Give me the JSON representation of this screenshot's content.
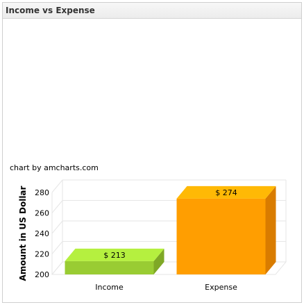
{
  "panel": {
    "title": "Income vs Expense"
  },
  "credit": "chart by amcharts.com",
  "colors": {
    "income": "#99cc33",
    "expense": "#ff9e01"
  },
  "chart_data": {
    "type": "bar",
    "categories": [
      "Income",
      "Expense"
    ],
    "values": [
      213,
      274
    ],
    "data_labels": [
      "$ 213",
      "$ 274"
    ],
    "ylabel": "Amount in US Dollar",
    "xlabel": "",
    "ylim": [
      200,
      280
    ],
    "yticks": [
      200,
      220,
      240,
      260,
      280
    ],
    "grid": true,
    "style": "3d"
  }
}
